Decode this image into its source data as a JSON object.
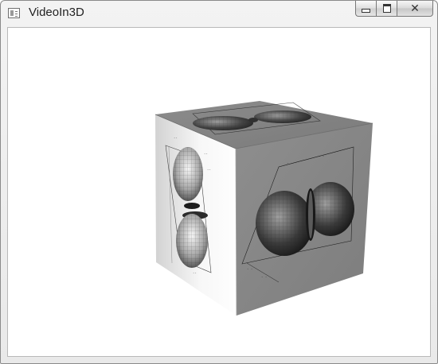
{
  "window": {
    "title": "VideoIn3D",
    "icon": "app-window-icon"
  },
  "caption_buttons": {
    "minimize_icon": "minimize-icon",
    "maximize_icon": "maximize-icon",
    "close_icon": "close-icon",
    "close_glyph": "✕"
  },
  "scene": {
    "object": "cube",
    "faces": [
      "top-face",
      "front-face",
      "side-face"
    ],
    "content": "3D polar lobe plot rendered as texture on each visible face"
  }
}
